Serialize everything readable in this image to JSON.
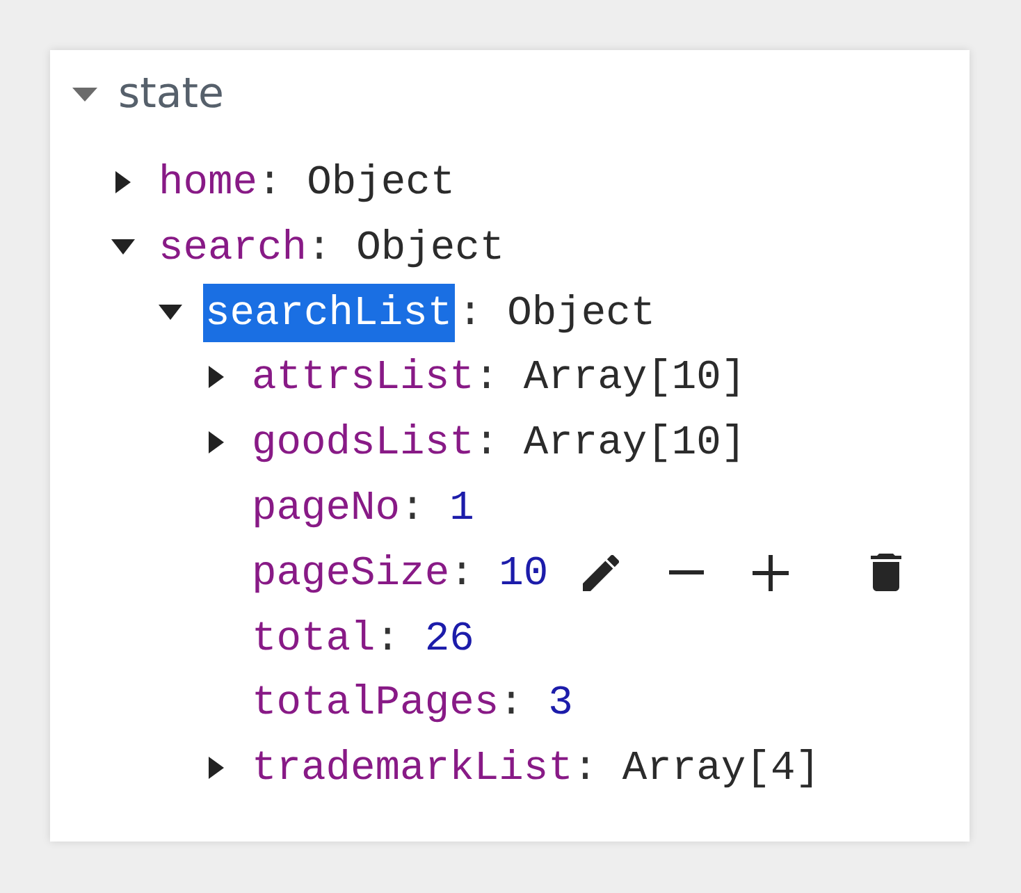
{
  "root": {
    "label": "state",
    "expanded": true,
    "children": [
      {
        "key": "home",
        "sep": ":",
        "value": "Object",
        "kind": "object",
        "expanded": false,
        "selected": false,
        "hovered": false
      },
      {
        "key": "search",
        "sep": ":",
        "value": "Object",
        "kind": "object",
        "expanded": true,
        "selected": false,
        "hovered": false,
        "children": [
          {
            "key": "searchList",
            "sep": ":",
            "value": "Object",
            "kind": "object",
            "expanded": true,
            "selected": true,
            "hovered": false,
            "children": [
              {
                "key": "attrsList",
                "sep": ":",
                "value": "Array[10]",
                "kind": "object",
                "expanded": false,
                "selected": false,
                "hovered": false
              },
              {
                "key": "goodsList",
                "sep": ":",
                "value": "Array[10]",
                "kind": "object",
                "expanded": false,
                "selected": false,
                "hovered": false
              },
              {
                "key": "pageNo",
                "sep": ":",
                "value": "1",
                "kind": "number",
                "selected": false,
                "hovered": false
              },
              {
                "key": "pageSize",
                "sep": ":",
                "value": "10",
                "kind": "number",
                "selected": false,
                "hovered": true
              },
              {
                "key": "total",
                "sep": ":",
                "value": "26",
                "kind": "number",
                "selected": false,
                "hovered": false
              },
              {
                "key": "totalPages",
                "sep": ":",
                "value": "3",
                "kind": "number",
                "selected": false,
                "hovered": false
              },
              {
                "key": "trademarkList",
                "sep": ":",
                "value": "Array[4]",
                "kind": "object",
                "expanded": false,
                "selected": false,
                "hovered": false
              }
            ]
          }
        ]
      }
    ]
  }
}
